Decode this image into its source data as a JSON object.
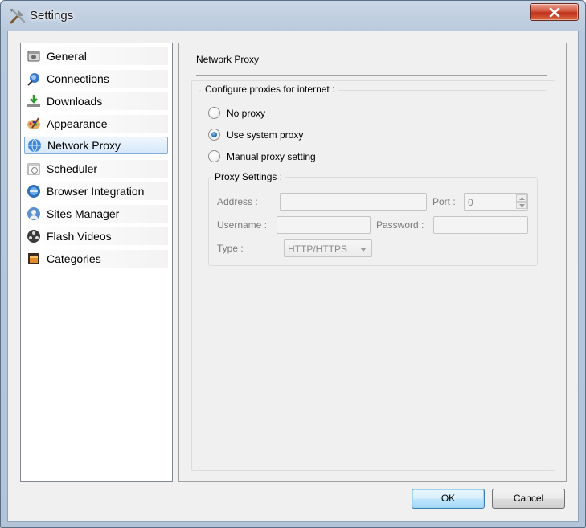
{
  "window": {
    "title": "Settings"
  },
  "sidebar": {
    "selected_index": 4,
    "items": [
      {
        "label": "General",
        "icon": "general-icon"
      },
      {
        "label": "Connections",
        "icon": "connections-icon"
      },
      {
        "label": "Downloads",
        "icon": "downloads-icon"
      },
      {
        "label": "Appearance",
        "icon": "appearance-icon"
      },
      {
        "label": "Network Proxy",
        "icon": "network-proxy-icon"
      },
      {
        "label": "Scheduler",
        "icon": "scheduler-icon"
      },
      {
        "label": "Browser Integration",
        "icon": "browser-integration-icon"
      },
      {
        "label": "Sites Manager",
        "icon": "sites-manager-icon"
      },
      {
        "label": "Flash Videos",
        "icon": "flash-videos-icon"
      },
      {
        "label": "Categories",
        "icon": "categories-icon"
      }
    ]
  },
  "panel": {
    "title": "Network Proxy",
    "group_title": "Configure proxies for internet :",
    "options": [
      {
        "label": "No proxy",
        "checked": false
      },
      {
        "label": "Use system proxy",
        "checked": true
      },
      {
        "label": "Manual proxy setting",
        "checked": false
      }
    ],
    "proxy_settings": {
      "title": "Proxy Settings :",
      "address_label": "Address :",
      "address_value": "",
      "port_label": "Port :",
      "port_value": "0",
      "username_label": "Username :",
      "username_value": "",
      "password_label": "Password :",
      "password_value": "",
      "type_label": "Type :",
      "type_value": "HTTP/HTTPS"
    }
  },
  "buttons": {
    "ok": "OK",
    "cancel": "Cancel"
  },
  "colors": {
    "selection_border": "#84acdd",
    "close_red": "#c0311c",
    "default_button_border": "#3c7fb1"
  }
}
